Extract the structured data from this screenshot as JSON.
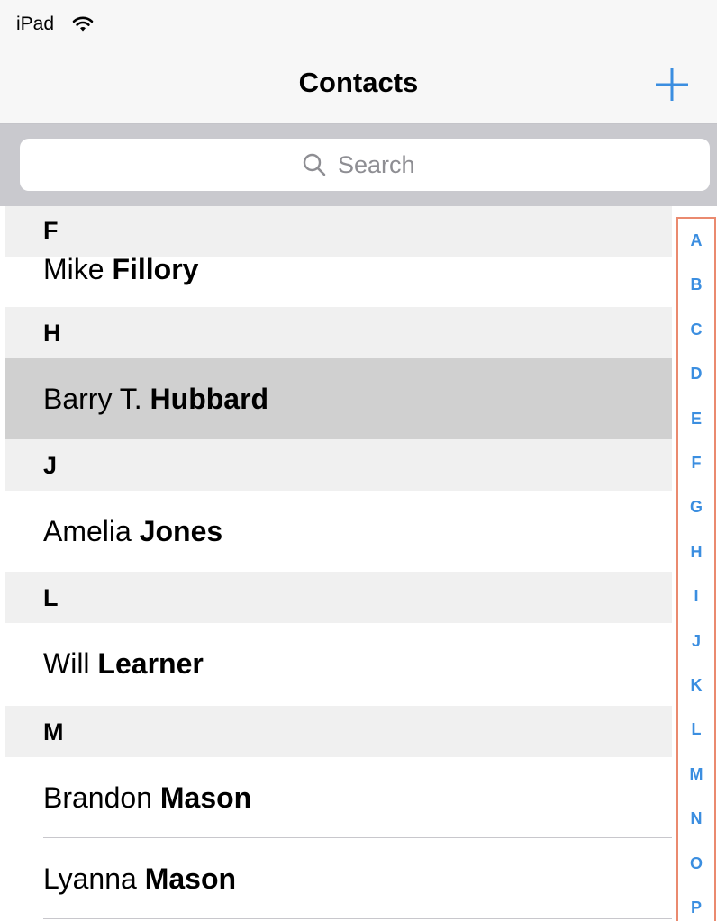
{
  "status_bar": {
    "device": "iPad"
  },
  "nav": {
    "title": "Contacts"
  },
  "search": {
    "placeholder": "Search"
  },
  "sections": [
    {
      "letter": "F"
    },
    {
      "letter": "H"
    },
    {
      "letter": "J"
    },
    {
      "letter": "L"
    },
    {
      "letter": "M"
    }
  ],
  "contacts": [
    {
      "first": "Mike",
      "last": "Fillory"
    },
    {
      "first": "Barry T.",
      "last": "Hubbard",
      "selected": true
    },
    {
      "first": "Amelia",
      "last": "Jones"
    },
    {
      "first": "Will",
      "last": "Learner"
    },
    {
      "first": "Brandon",
      "last": "Mason"
    },
    {
      "first": "Lyanna",
      "last": "Mason"
    }
  ],
  "index_letters": [
    "A",
    "B",
    "C",
    "D",
    "E",
    "F",
    "G",
    "H",
    "I",
    "J",
    "K",
    "L",
    "M",
    "N",
    "O",
    "P"
  ],
  "colors": {
    "accent": "#3b8ee0",
    "index_highlight": "#ea8a6f",
    "selected_row": "#d0d0d0"
  }
}
